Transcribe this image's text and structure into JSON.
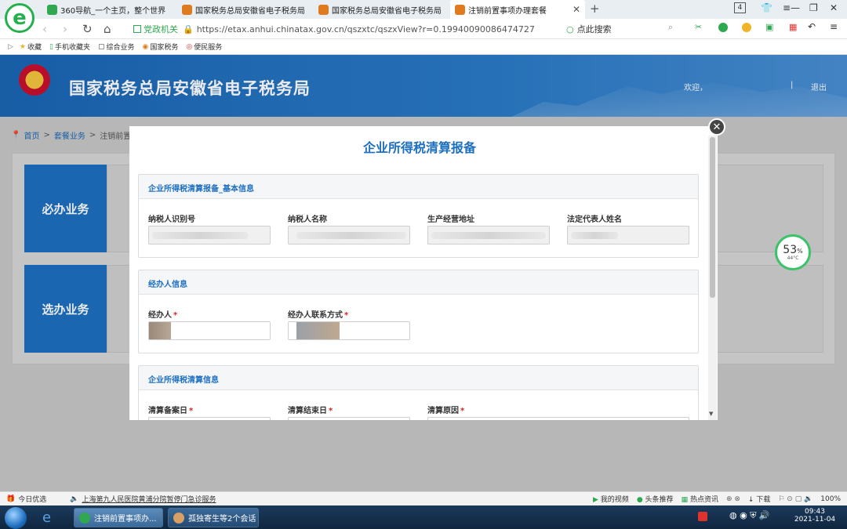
{
  "browser": {
    "tabs": [
      {
        "label": "360导航_一个主页，整个世界"
      },
      {
        "label": "国家税务总局安徽省电子税务局"
      },
      {
        "label": "国家税务总局安徽省电子税务局"
      },
      {
        "label": "注销前置事项办理套餐"
      }
    ],
    "tab_count": "4",
    "gov_badge": "党政机关",
    "url": "https://etax.anhui.chinatax.gov.cn/qszxtc/qszxView?r=0.19940090086474727",
    "search_placeholder": "点此搜索",
    "bookmarks": [
      "收藏",
      "手机收藏夹",
      "综合业务",
      "国家税务",
      "便民服务"
    ]
  },
  "site": {
    "title": "国家税务总局安徽省电子税务局",
    "welcome": "欢迎，",
    "logout": "退出"
  },
  "breadcrumb": {
    "home": "首页",
    "package": "套餐业务",
    "current": "注销前置"
  },
  "business": {
    "required": "必办业务",
    "optional": "选办业务"
  },
  "modal": {
    "title": "企业所得税清算报备",
    "sections": {
      "basic": {
        "title": "企业所得税清算报备_基本信息",
        "fields": [
          "纳税人识别号",
          "纳税人名称",
          "生产经营地址",
          "法定代表人姓名"
        ]
      },
      "agent": {
        "title": "经办人信息",
        "fields": [
          "经办人",
          "经办人联系方式"
        ]
      },
      "liquidation": {
        "title": "企业所得税清算信息",
        "fields": [
          "清算备案日",
          "清算结束日",
          "清算原因"
        ]
      }
    }
  },
  "widget": {
    "percent": "53",
    "unit": "%",
    "temperature": "44°C"
  },
  "statusbar": {
    "today": "今日优选",
    "news": "上海第九人民医院黄浦分院暂停门急诊服务",
    "items": [
      "我的视频",
      "头条推荐",
      "热点资讯",
      "下载"
    ],
    "zoom": "100%"
  },
  "taskbar": {
    "apps": [
      "注销前置事项办...",
      "孤独寄生等2个会话"
    ],
    "time": "09:43",
    "date": "2021-11-04"
  }
}
